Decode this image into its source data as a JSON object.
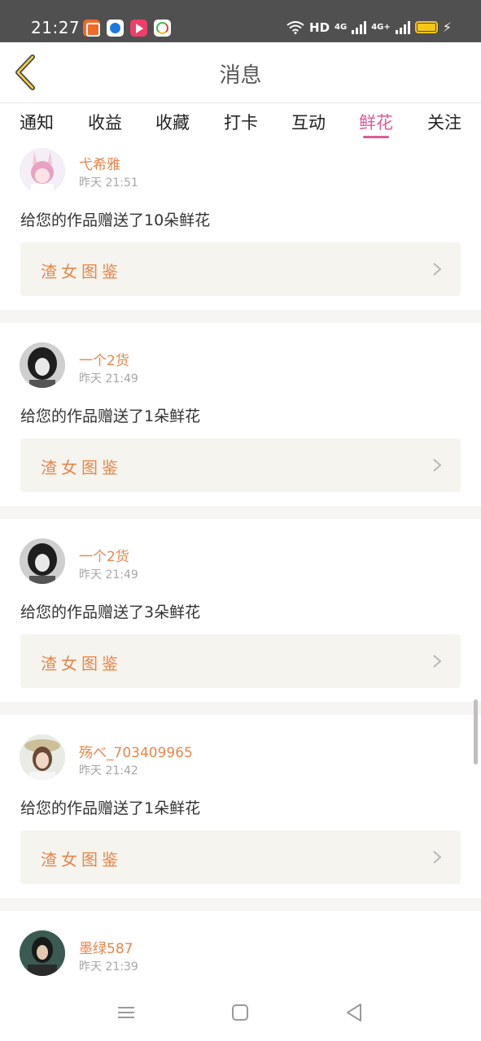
{
  "status_bar": {
    "time": "21:27",
    "network_label": "HD",
    "signal1_label": "4G",
    "signal2_label": "4G+",
    "apps": [
      "app-orange-icon",
      "app-blue-icon",
      "app-red-play-icon",
      "app-colorful-icon"
    ],
    "battery_level": 1.0
  },
  "header": {
    "title": "消息",
    "back_icon": "chevron-left-icon"
  },
  "tabs": [
    {
      "label": "通知",
      "active": false
    },
    {
      "label": "收益",
      "active": false
    },
    {
      "label": "收藏",
      "active": false
    },
    {
      "label": "打卡",
      "active": false
    },
    {
      "label": "互动",
      "active": false
    },
    {
      "label": "鲜花",
      "active": true
    },
    {
      "label": "关注",
      "active": false
    }
  ],
  "colors": {
    "accent": "#e05a9a",
    "username": "#e7864a",
    "status_bar": "#505050",
    "card_bg": "#f5f4ee"
  },
  "messages": [
    {
      "username": "弋希雅",
      "time": "昨天 21:51",
      "text": "给您的作品赠送了10朵鲜花",
      "work_title": "渣女图鉴"
    },
    {
      "username": "一个2货",
      "time": "昨天 21:49",
      "text": "给您的作品赠送了1朵鲜花",
      "work_title": "渣女图鉴"
    },
    {
      "username": "一个2货",
      "time": "昨天 21:49",
      "text": "给您的作品赠送了3朵鲜花",
      "work_title": "渣女图鉴"
    },
    {
      "username": "殇べ_703409965",
      "time": "昨天 21:42",
      "text": "给您的作品赠送了1朵鲜花",
      "work_title": "渣女图鉴"
    },
    {
      "username": "墨绿587",
      "time": "昨天 21:39",
      "text": "",
      "work_title": ""
    }
  ],
  "navbar": {
    "items": [
      "menu-icon",
      "home-square-icon",
      "back-triangle-icon"
    ]
  }
}
